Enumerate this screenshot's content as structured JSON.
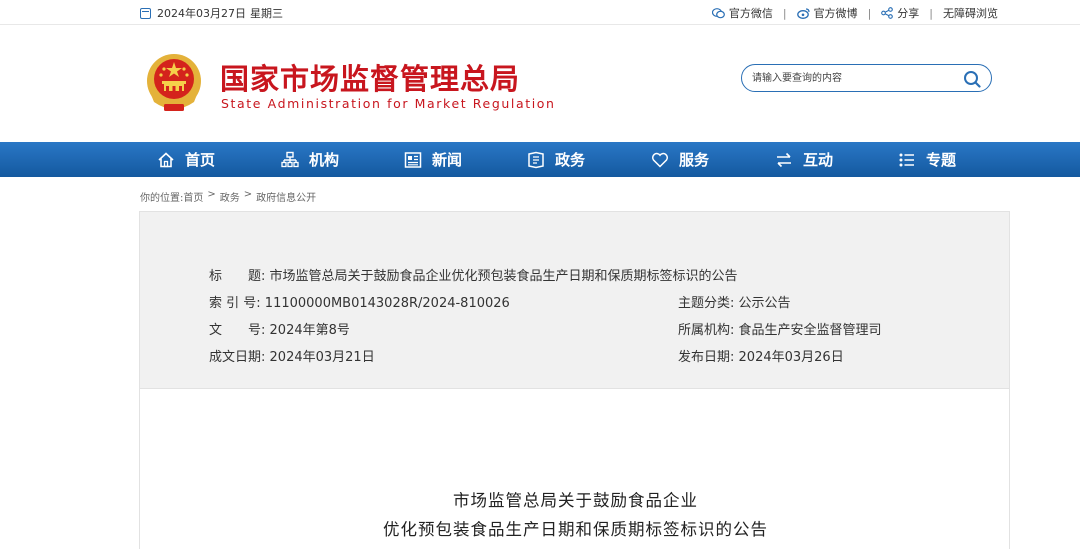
{
  "topbar": {
    "date": "2024年03月27日",
    "weekday": "星期三",
    "links": [
      {
        "label": "官方微信",
        "icon": "wechat-icon"
      },
      {
        "label": "官方微博",
        "icon": "weibo-icon"
      },
      {
        "label": "分享",
        "icon": "share-icon"
      },
      {
        "label": "无障碍浏览",
        "icon": ""
      }
    ]
  },
  "header": {
    "title": "国家市场监督管理总局",
    "subtitle": "State Administration for Market Regulation",
    "search_placeholder": "请输入要查询的内容"
  },
  "nav": {
    "items": [
      {
        "label": "首页",
        "icon": "home-icon"
      },
      {
        "label": "机构",
        "icon": "org-chart-icon"
      },
      {
        "label": "新闻",
        "icon": "news-icon"
      },
      {
        "label": "政务",
        "icon": "government-icon"
      },
      {
        "label": "服务",
        "icon": "heart-icon"
      },
      {
        "label": "互动",
        "icon": "exchange-arrows-icon"
      },
      {
        "label": "专题",
        "icon": "topic-list-icon"
      }
    ]
  },
  "breadcrumb": {
    "prefix": "你的位置:",
    "items": [
      "首页",
      "政务",
      "政府信息公开"
    ],
    "separator": ">"
  },
  "info": {
    "title_label": "标　　题:",
    "title_value": "市场监管总局关于鼓励食品企业优化预包装食品生产日期和保质期标签标识的公告",
    "index_label": "索 引 号:",
    "index_value": "11100000MB0143028R/2024-810026",
    "category_label": "主题分类:",
    "category_value": "公示公告",
    "docno_label": "文　　号:",
    "docno_value": "2024年第8号",
    "org_label": "所属机构:",
    "org_value": "食品生产安全监督管理司",
    "created_label": "成文日期:",
    "created_value": "2024年03月21日",
    "published_label": "发布日期:",
    "published_value": "2024年03月26日"
  },
  "document": {
    "title_line1": "市场监管总局关于鼓励食品企业",
    "title_line2": "优化预包装食品生产日期和保质期标签标识的公告"
  },
  "colors": {
    "brand_red": "#c8161e",
    "nav_blue": "#1f68b2",
    "panel_gray": "#f1f1f1"
  }
}
